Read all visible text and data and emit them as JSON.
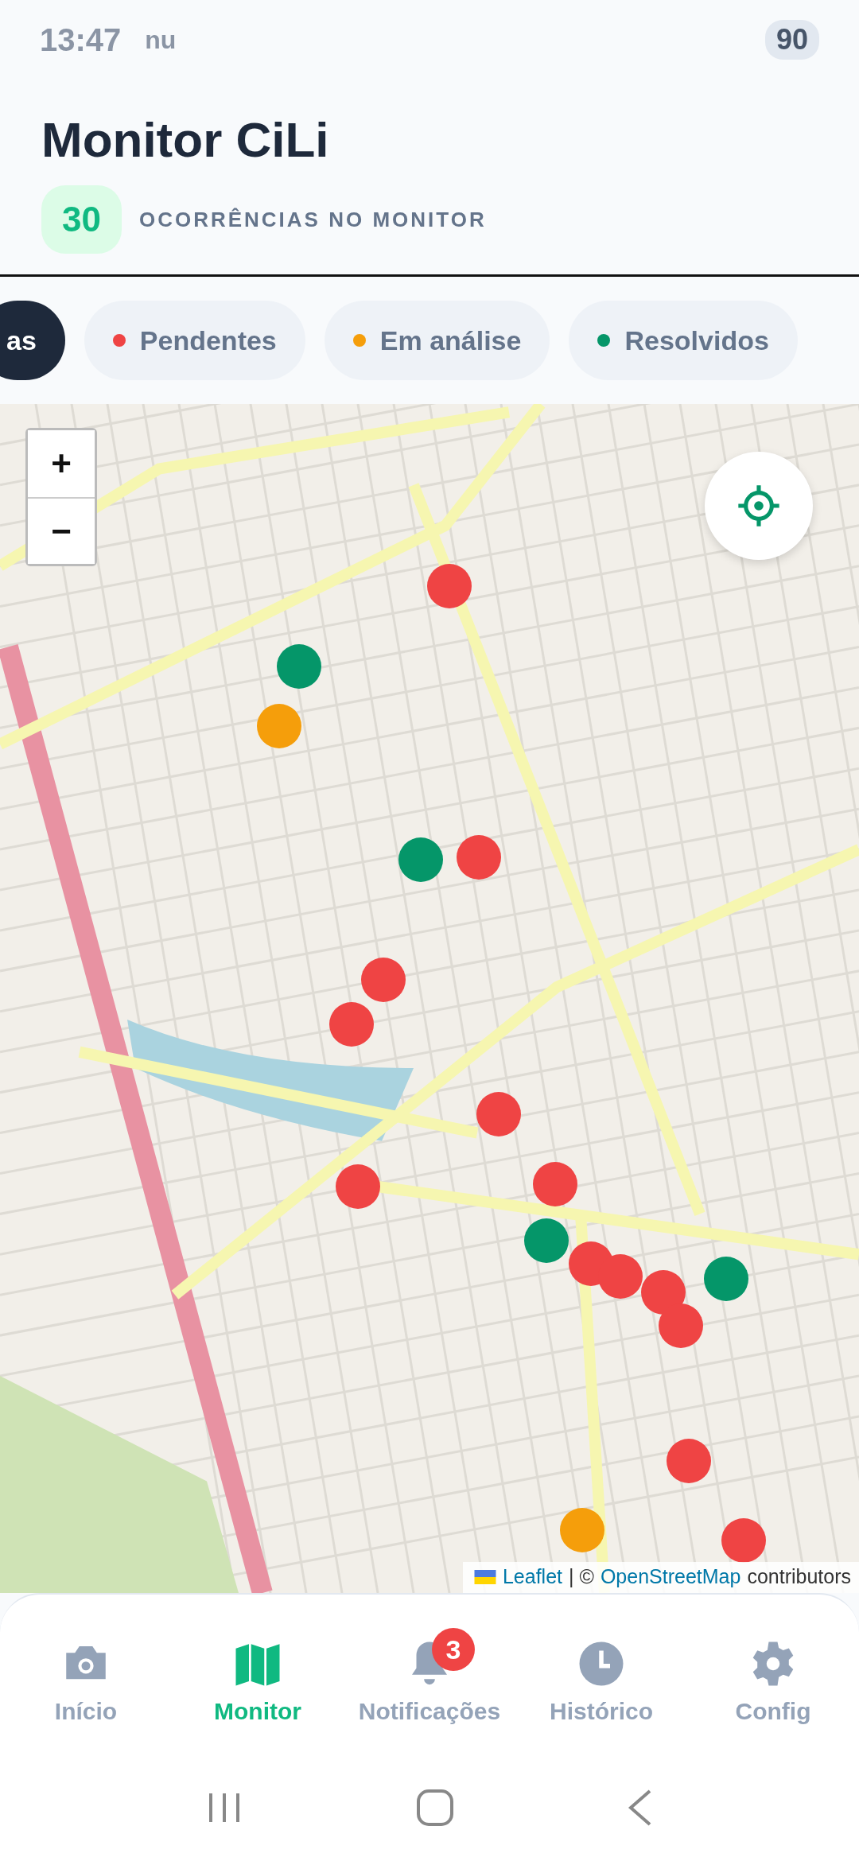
{
  "status_bar": {
    "time": "13:47",
    "carrier": "nu",
    "battery": "90"
  },
  "header": {
    "title": "Monitor CiLi",
    "count": "30",
    "count_label": "OCORRÊNCIAS NO MONITOR"
  },
  "filters": [
    {
      "label": "as",
      "selected": true
    },
    {
      "label": "Pendentes",
      "selected": false,
      "color": "#ef4444"
    },
    {
      "label": "Em análise",
      "selected": false,
      "color": "#f59e0b"
    },
    {
      "label": "Resolvidos",
      "selected": false,
      "color": "#059669"
    }
  ],
  "map": {
    "zoom_in": "+",
    "zoom_out": "−",
    "attribution": {
      "leaflet": "Leaflet",
      "separator": "| ©",
      "osm": "OpenStreetMap",
      "suffix": "contributors"
    },
    "markers": [
      {
        "color": "#ef4444"
      },
      {
        "color": "#059669"
      },
      {
        "color": "#f59e0b"
      },
      {
        "color": "#059669"
      },
      {
        "color": "#ef4444"
      },
      {
        "color": "#ef4444"
      },
      {
        "color": "#ef4444"
      },
      {
        "color": "#ef4444"
      },
      {
        "color": "#ef4444"
      },
      {
        "color": "#ef4444"
      },
      {
        "color": "#059669"
      },
      {
        "color": "#ef4444"
      },
      {
        "color": "#ef4444"
      },
      {
        "color": "#ef4444"
      },
      {
        "color": "#059669"
      },
      {
        "color": "#ef4444"
      },
      {
        "color": "#ef4444"
      },
      {
        "color": "#f59e0b"
      },
      {
        "color": "#ef4444"
      }
    ]
  },
  "nav": [
    {
      "kind": "camera",
      "label": "Início",
      "selected": false
    },
    {
      "kind": "map",
      "label": "Monitor",
      "selected": true
    },
    {
      "kind": "bell",
      "label": "Notificações",
      "selected": false,
      "badge": "3"
    },
    {
      "kind": "clock",
      "label": "Histórico",
      "selected": false
    },
    {
      "kind": "gear",
      "label": "Config",
      "selected": false
    }
  ]
}
